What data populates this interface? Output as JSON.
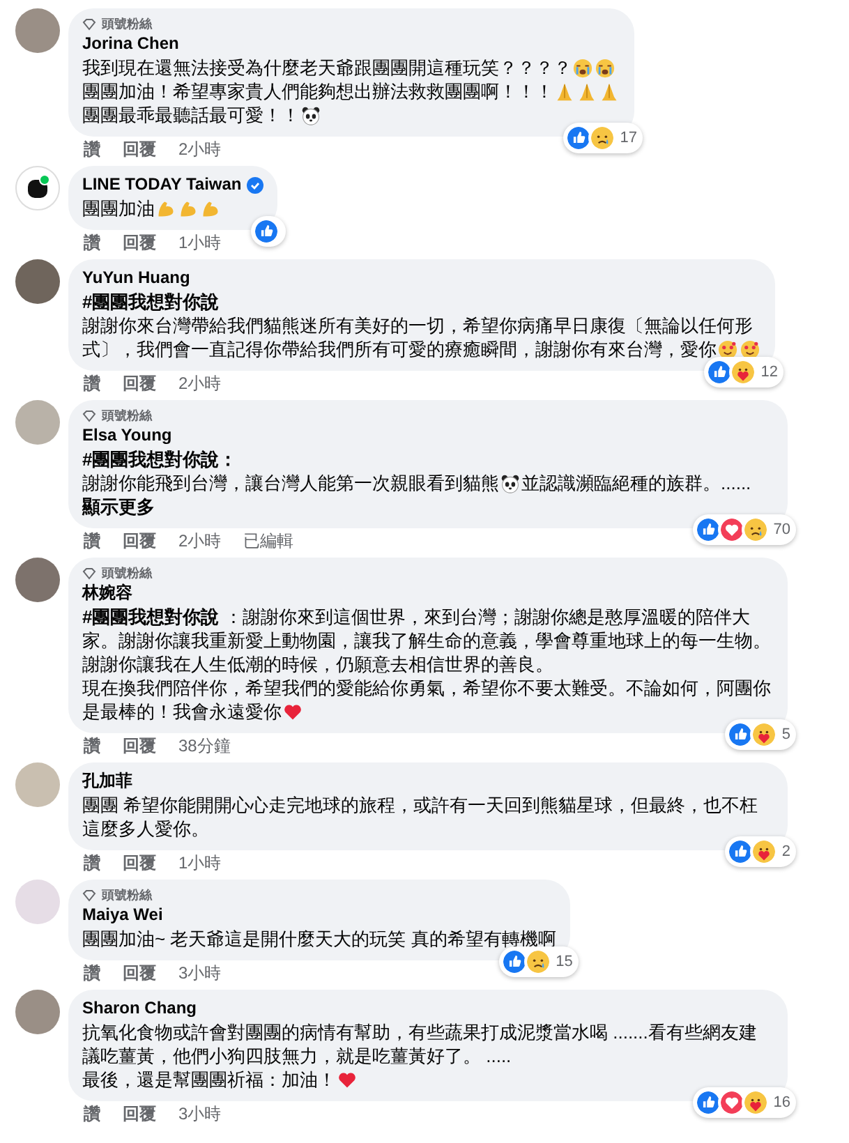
{
  "comments": [
    {
      "author": "Jorina Chen",
      "badge": "頭號粉絲",
      "avatar": {
        "kind": "photo"
      },
      "verified": false,
      "lines": [
        {
          "text": "我到現在還無法接受為什麼老天爺跟團團開這種玩笑？？？？",
          "emojis": [
            {
              "kind": "cry"
            },
            {
              "kind": "cry"
            }
          ]
        },
        {
          "text": "團團加油！希望專家貴人們能夠想出辦法救救團團啊！！！",
          "emojis": [
            {
              "kind": "pray"
            },
            {
              "kind": "pray"
            },
            {
              "kind": "pray"
            }
          ]
        },
        {
          "text": "團團最乖最聽話最可愛！！",
          "emojis": [
            {
              "kind": "panda"
            }
          ]
        }
      ],
      "actions": [
        "讚",
        "回覆"
      ],
      "time": "2小時",
      "reactions": {
        "icons": [
          {
            "kind": "like"
          },
          {
            "kind": "sad"
          }
        ],
        "count": "17"
      }
    },
    {
      "author": "LINE TODAY Taiwan",
      "avatar": {
        "kind": "logo"
      },
      "verified": true,
      "lines": [
        {
          "text": "團團加油",
          "emojis": [
            {
              "kind": "muscle"
            },
            {
              "kind": "muscle"
            },
            {
              "kind": "muscle"
            }
          ]
        }
      ],
      "actions": [
        "讚",
        "回覆"
      ],
      "time": "1小時",
      "reactions": {
        "icons": [
          {
            "kind": "like"
          }
        ]
      }
    },
    {
      "author": "YuYun Huang",
      "avatar": {
        "kind": "photo"
      },
      "verified": false,
      "lines": [
        {
          "text": "**#團團我想對你說**"
        },
        {
          "text": "謝謝你來台灣帶給我們貓熊迷所有美好的一切，希望你病痛早日康復〔無論以任何形"
        },
        {
          "text": "式〕，我們會一直記得你帶給我們所有可愛的療癒瞬間，謝謝你有來台灣，愛你",
          "emojis": [
            {
              "kind": "love"
            },
            {
              "kind": "love"
            }
          ]
        }
      ],
      "actions": [
        "讚",
        "回覆"
      ],
      "time": "2小時",
      "reactions": {
        "icons": [
          {
            "kind": "like"
          },
          {
            "kind": "care"
          }
        ],
        "count": "12"
      }
    },
    {
      "author": "Elsa Young",
      "badge": "頭號粉絲",
      "avatar": {
        "kind": "photo"
      },
      "verified": false,
      "lines": [
        {
          "text": "**#團團我想對你說：**"
        },
        {
          "text": "謝謝你能飛到台灣，讓台灣人能第一次親眼看到貓熊",
          "emojis": [
            {
              "kind": "panda"
            }
          ],
          "after": "並認識瀕臨絕種的族群。......",
          "link": "顯示更多"
        }
      ],
      "actions": [
        "讚",
        "回覆"
      ],
      "time": "2小時",
      "edited": "已編輯",
      "reactions": {
        "icons": [
          {
            "kind": "like"
          },
          {
            "kind": "love"
          },
          {
            "kind": "sad"
          }
        ],
        "count": "70"
      }
    },
    {
      "author": "林婉容",
      "badge": "頭號粉絲",
      "avatar": {
        "kind": "photo"
      },
      "verified": false,
      "lines": [
        {
          "text": "**#團團我想對你說** ：謝謝你來到這個世界，來到台灣；謝謝你總是憨厚溫暖的陪伴大家。謝謝你讓我重新愛上動物園，讓我了解生命的意義，學會尊重地球上的每一生物。"
        },
        {
          "text": "謝謝你讓我在人生低潮的時候，仍願意去相信世界的善良。"
        },
        {
          "text": "現在換我們陪伴你，希望我們的愛能給你勇氣，希望你不要太難受。不論如何，阿團你"
        },
        {
          "text": "是最棒的！我會永遠愛你",
          "emojis": [
            {
              "kind": "heart"
            }
          ]
        }
      ],
      "actions": [
        "讚",
        "回覆"
      ],
      "time": "38分鐘",
      "reactions": {
        "icons": [
          {
            "kind": "like"
          },
          {
            "kind": "care"
          }
        ],
        "count": "5"
      }
    },
    {
      "author": "孔加菲",
      "avatar": {
        "kind": "photo"
      },
      "verified": false,
      "lines": [
        {
          "text": "團團 希望你能開開心心走完地球的旅程，或許有一天回到熊貓星球，但最終，也不枉這麼多人愛你。"
        }
      ],
      "actions": [
        "讚",
        "回覆"
      ],
      "time": "1小時",
      "reactions": {
        "icons": [
          {
            "kind": "like"
          },
          {
            "kind": "care"
          }
        ],
        "count": "2"
      }
    },
    {
      "author": "Maiya Wei",
      "badge": "頭號粉絲",
      "avatar": {
        "kind": "photo"
      },
      "verified": false,
      "lines": [
        {
          "text": "團團加油~ 老天爺這是開什麼天大的玩笑 真的希望有轉機啊"
        }
      ],
      "actions": [
        "讚",
        "回覆"
      ],
      "time": "3小時",
      "reactions": {
        "icons": [
          {
            "kind": "like"
          },
          {
            "kind": "sad"
          }
        ],
        "count": "15"
      }
    },
    {
      "author": "Sharon Chang",
      "avatar": {
        "kind": "photo"
      },
      "verified": false,
      "lines": [
        {
          "text": "抗氧化食物或許會對團團的病情有幫助，有些蔬果打成泥漿當水喝 .......看有些網友建議吃薑黃，他們小狗四肢無力，就是吃薑黃好了。 ....."
        },
        {
          "text": "最後，還是幫團團祈福：加油！",
          "emojis": [
            {
              "kind": "heart"
            }
          ]
        }
      ],
      "actions": [
        "讚",
        "回覆"
      ],
      "time": "3小時",
      "reactions": {
        "icons": [
          {
            "kind": "like"
          },
          {
            "kind": "love"
          },
          {
            "kind": "care"
          }
        ],
        "count": "16"
      }
    }
  ]
}
